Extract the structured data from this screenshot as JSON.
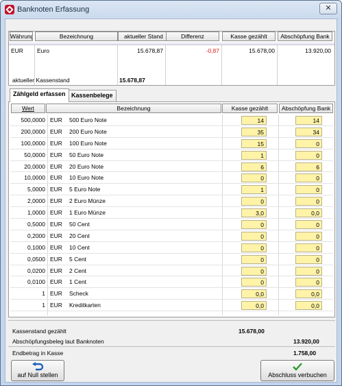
{
  "window": {
    "title": "Banknoten Erfassung",
    "close": "✕"
  },
  "currency_grid": {
    "headers": [
      "Währung",
      "Bezeichnung",
      "aktueller Stand",
      "Differenz",
      "Kasse gezählt",
      "Abschöpfung Bank"
    ],
    "rows": [
      {
        "waehrung": "EUR",
        "bezeichnung": "Euro",
        "stand": "15.678,87",
        "differenz": "-0,87",
        "kasse": "15.678,00",
        "bank": "13.920,00"
      }
    ]
  },
  "kassenstand": {
    "label": "aktueller Kassenstand",
    "value": "15.678,87"
  },
  "tabs": [
    {
      "label": "Zählgeld erfassen",
      "active": true
    },
    {
      "label": "Kassenbelege",
      "active": false
    }
  ],
  "notes_grid": {
    "headers": {
      "wert": "Wert",
      "bezeichnung": "Bezeichnung",
      "kasse": "Kasse gezählt",
      "bank": "Abschöpfung Bank"
    },
    "rows": [
      {
        "wert": "500,0000",
        "cur": "EUR",
        "name": "500 Euro Note",
        "kasse": "14",
        "bank": "14"
      },
      {
        "wert": "200,0000",
        "cur": "EUR",
        "name": "200 Euro Note",
        "kasse": "35",
        "bank": "34"
      },
      {
        "wert": "100,0000",
        "cur": "EUR",
        "name": "100 Euro Note",
        "kasse": "15",
        "bank": "0"
      },
      {
        "wert": "50,0000",
        "cur": "EUR",
        "name": "50 Euro Note",
        "kasse": "1",
        "bank": "0"
      },
      {
        "wert": "20,0000",
        "cur": "EUR",
        "name": "20 Euro Note",
        "kasse": "6",
        "bank": "6"
      },
      {
        "wert": "10,0000",
        "cur": "EUR",
        "name": "10 Euro Note",
        "kasse": "0",
        "bank": "0"
      },
      {
        "wert": "5,0000",
        "cur": "EUR",
        "name": "5 Euro Note",
        "kasse": "1",
        "bank": "0"
      },
      {
        "wert": "2,0000",
        "cur": "EUR",
        "name": "2 Euro Münze",
        "kasse": "0",
        "bank": "0"
      },
      {
        "wert": "1,0000",
        "cur": "EUR",
        "name": "1 Euro Münze",
        "kasse": "3,0",
        "bank": "0,0"
      },
      {
        "wert": "0,5000",
        "cur": "EUR",
        "name": "50 Cent",
        "kasse": "0",
        "bank": "0"
      },
      {
        "wert": "0,2000",
        "cur": "EUR",
        "name": "20 Cent",
        "kasse": "0",
        "bank": "0"
      },
      {
        "wert": "0,1000",
        "cur": "EUR",
        "name": "10 Cent",
        "kasse": "0",
        "bank": "0"
      },
      {
        "wert": "0,0500",
        "cur": "EUR",
        "name": "5 Cent",
        "kasse": "0",
        "bank": "0"
      },
      {
        "wert": "0,0200",
        "cur": "EUR",
        "name": "2 Cent",
        "kasse": "0",
        "bank": "0"
      },
      {
        "wert": "0,0100",
        "cur": "EUR",
        "name": "1 Cent",
        "kasse": "0",
        "bank": "0"
      },
      {
        "wert": "1",
        "cur": "EUR",
        "name": "Scheck",
        "kasse": "0,0",
        "bank": "0,0"
      },
      {
        "wert": "1",
        "cur": "EUR",
        "name": "Kreditkarten",
        "kasse": "0,0",
        "bank": "0,0"
      }
    ]
  },
  "summary": {
    "kassenstand_gezaehlt": {
      "label": "Kassenstand gezählt",
      "value": "15.678,00"
    },
    "abschoepfungsbeleg": {
      "label": "Abschöpfungsbeleg laut Banknoten",
      "value": "13.920,00"
    },
    "endbetrag": {
      "label": "Endbetrag in Kasse",
      "value": "1.758,00"
    }
  },
  "buttons": {
    "null_stellen": "auf Null stellen",
    "abschluss": "Abschluss verbuchen"
  },
  "colors": {
    "input_bg": "#fff3a8",
    "negative": "#e0201c",
    "check_icon": "#2c9a2c",
    "undo_icon": "#1b5fb8"
  }
}
